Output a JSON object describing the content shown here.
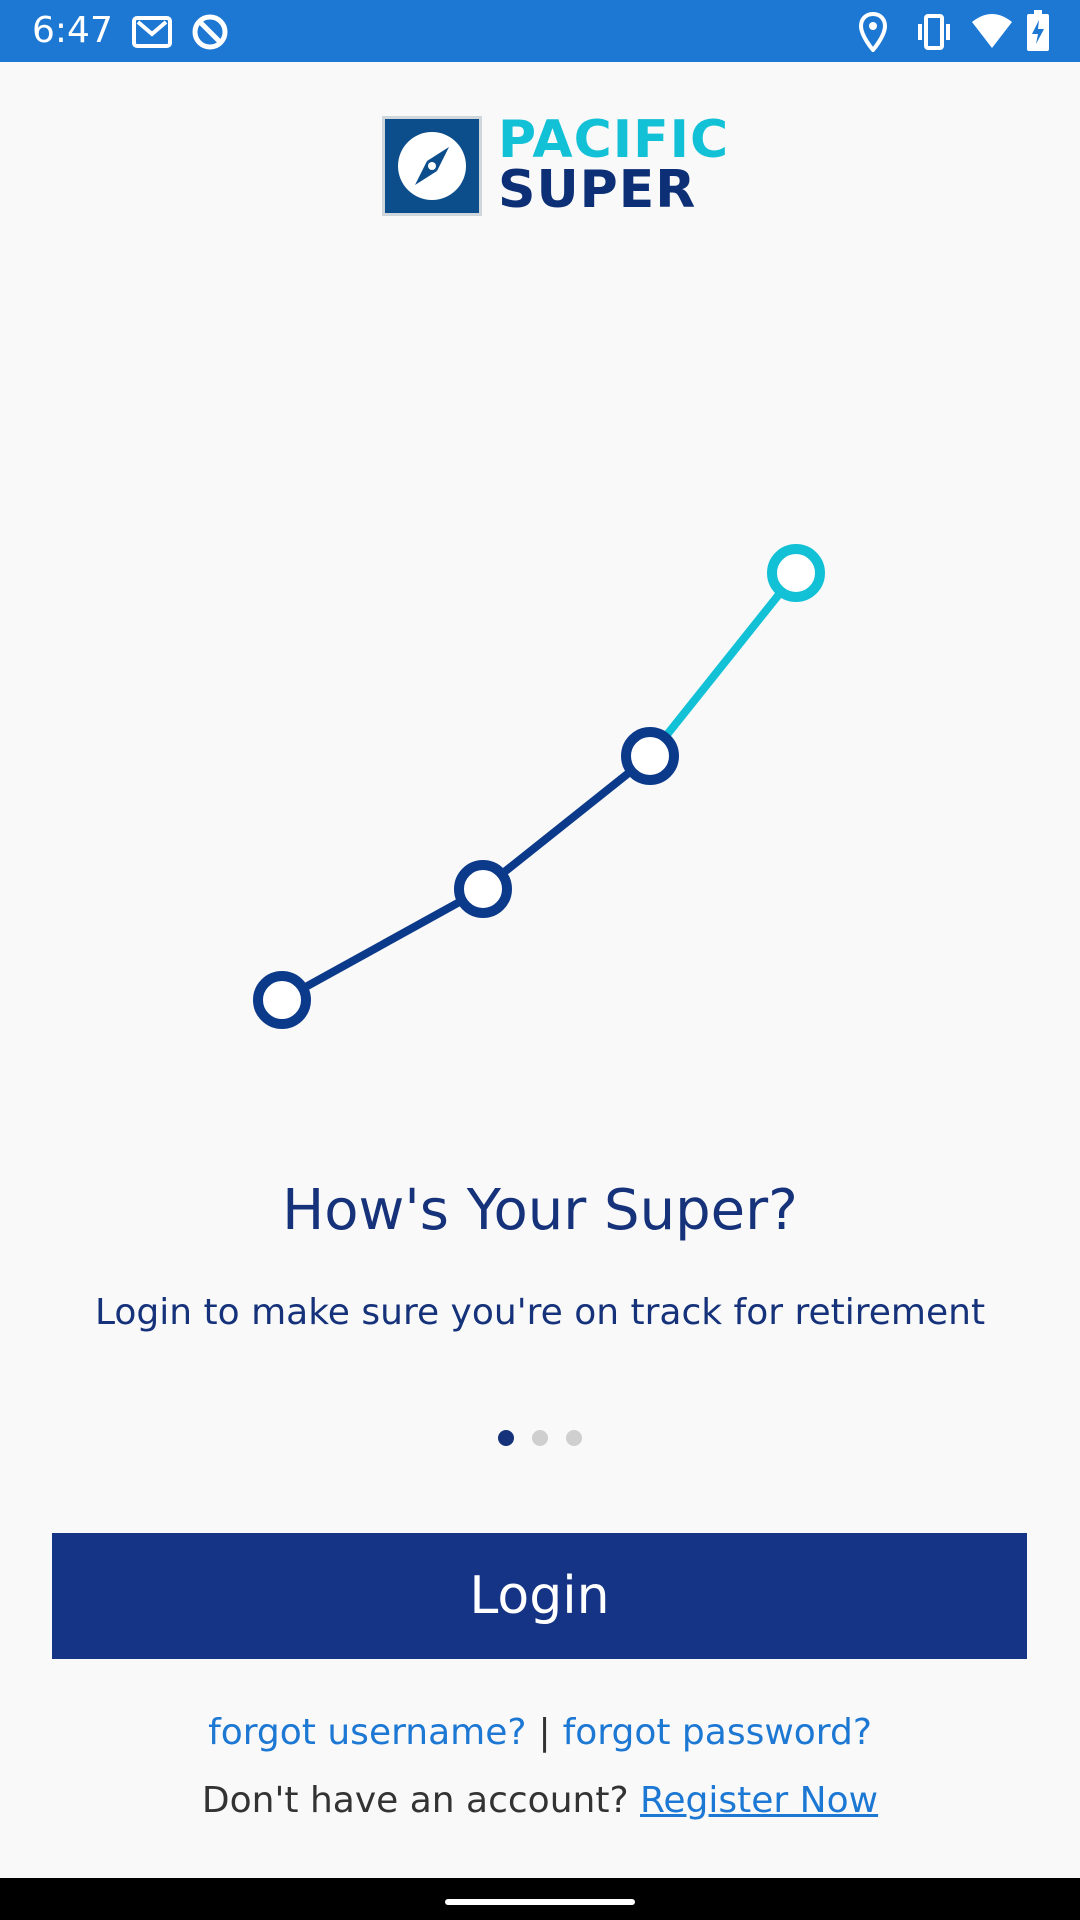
{
  "status_bar": {
    "time": "6:47",
    "left_icons": [
      "gmail-icon",
      "vpn-icon"
    ],
    "right_icons": [
      "location-icon",
      "vibrate-icon",
      "wifi-icon",
      "battery-charging-icon"
    ]
  },
  "logo": {
    "line1": "PACIFIC",
    "line2": "SUPER",
    "icon": "compass-icon",
    "colors": {
      "box": "#0c4d8c",
      "line1": "#12c1d6",
      "line2": "#0c2f76"
    }
  },
  "illustration": {
    "icon": "growth-line-icon",
    "colors": {
      "dark": "#0c3a8a",
      "accent": "#12c1d6"
    }
  },
  "onboarding": {
    "title": "How's Your Super?",
    "subtitle": "Login to make sure you're on track for retirement",
    "pager": {
      "count": 3,
      "active_index": 0
    }
  },
  "login_button": {
    "label": "Login",
    "color": "#153486"
  },
  "links": {
    "forgot_username": "forgot username?",
    "separator": "|",
    "forgot_password": "forgot password?",
    "no_account": "Don't have an account?",
    "register": "Register Now"
  }
}
